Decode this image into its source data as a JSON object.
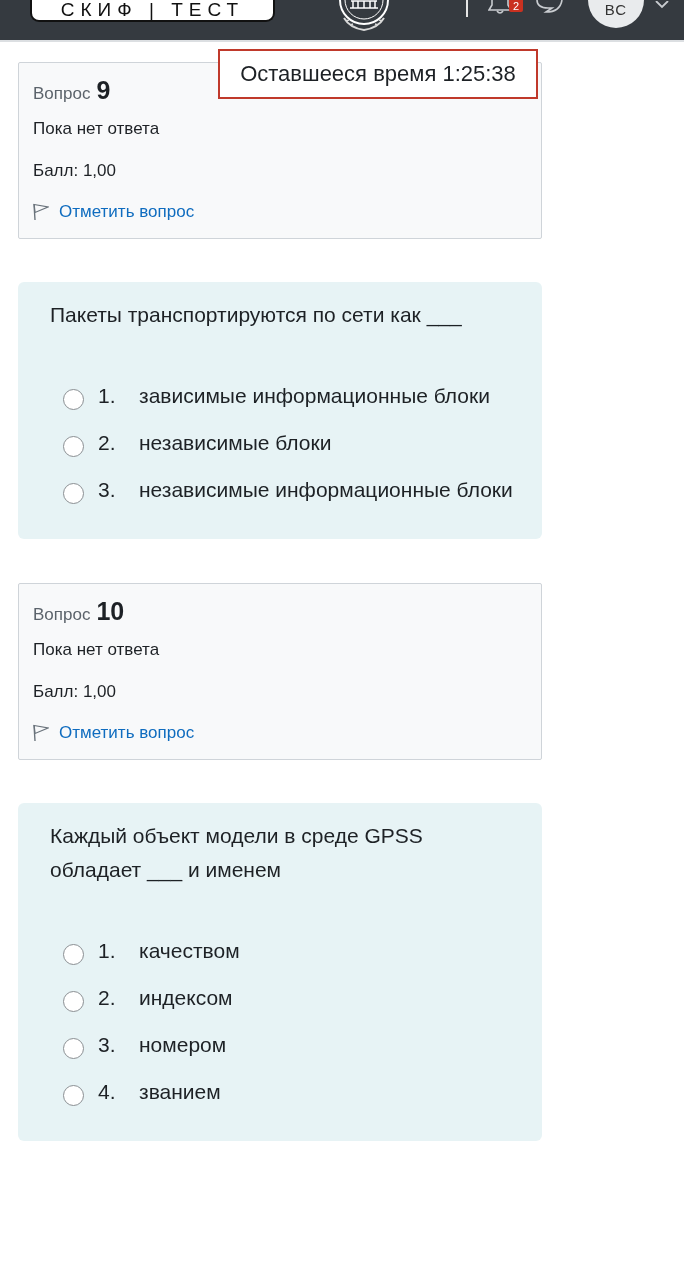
{
  "header": {
    "logo_text": "СКИФ | ТЕСТ",
    "notification_count": "2",
    "avatar_initials": "ВС"
  },
  "timer": {
    "text": "Оставшееся время 1:25:38"
  },
  "questions": [
    {
      "info": {
        "label": "Вопрос",
        "number": "9",
        "status": "Пока нет ответа",
        "grade": "Балл: 1,00",
        "flag_link": "Отметить вопрос",
        "flagged": false
      },
      "text": "Пакеты транспортируются по сети как ___",
      "options": [
        {
          "number": "1.",
          "text": "зависимые информационные блоки",
          "selected": false
        },
        {
          "number": "2.",
          "text": "независимые блоки",
          "selected": false
        },
        {
          "number": "3.",
          "text": "независимые информационные блоки",
          "selected": false
        }
      ]
    },
    {
      "info": {
        "label": "Вопрос",
        "number": "10",
        "status": "Пока нет ответа",
        "grade": "Балл: 1,00",
        "flag_link": "Отметить вопрос",
        "flagged": false
      },
      "text": "Каждый объект модели в среде GPSS обладает ___ и именем",
      "options": [
        {
          "number": "1.",
          "text": "качеством",
          "selected": false
        },
        {
          "number": "2.",
          "text": "индексом",
          "selected": false
        },
        {
          "number": "3.",
          "text": "номером",
          "selected": false
        },
        {
          "number": "4.",
          "text": "званием",
          "selected": false
        }
      ]
    }
  ]
}
